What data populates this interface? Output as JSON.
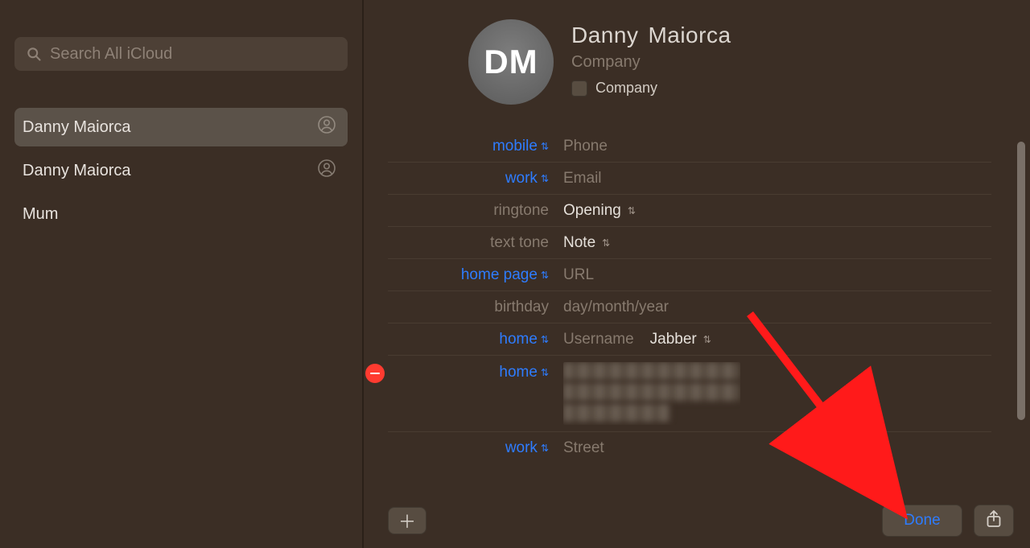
{
  "search": {
    "placeholder": "Search All iCloud"
  },
  "contacts": [
    {
      "name": "Danny  Maiorca",
      "selected": true,
      "hasIcon": true
    },
    {
      "name": "Danny Maiorca",
      "selected": false,
      "hasIcon": true
    },
    {
      "name": "Mum",
      "selected": false,
      "hasIcon": false
    }
  ],
  "card": {
    "initials": "DM",
    "first": "Danny",
    "last": "Maiorca",
    "company_placeholder": "Company",
    "company_checkbox_label": "Company"
  },
  "rows": {
    "mobile_label": "mobile",
    "mobile_placeholder": "Phone",
    "work_email_label": "work",
    "work_email_placeholder": "Email",
    "ringtone_label": "ringtone",
    "ringtone_value": "Opening",
    "texttone_label": "text tone",
    "texttone_value": "Note",
    "homepage_label": "home page",
    "homepage_placeholder": "URL",
    "birthday_label": "birthday",
    "birthday_placeholder": "day/month/year",
    "home_username_label": "home",
    "home_username_placeholder": "Username",
    "home_username_service": "Jabber",
    "home_address_label": "home",
    "work_address_label": "work",
    "work_address_placeholder": "Street"
  },
  "buttons": {
    "done": "Done"
  }
}
